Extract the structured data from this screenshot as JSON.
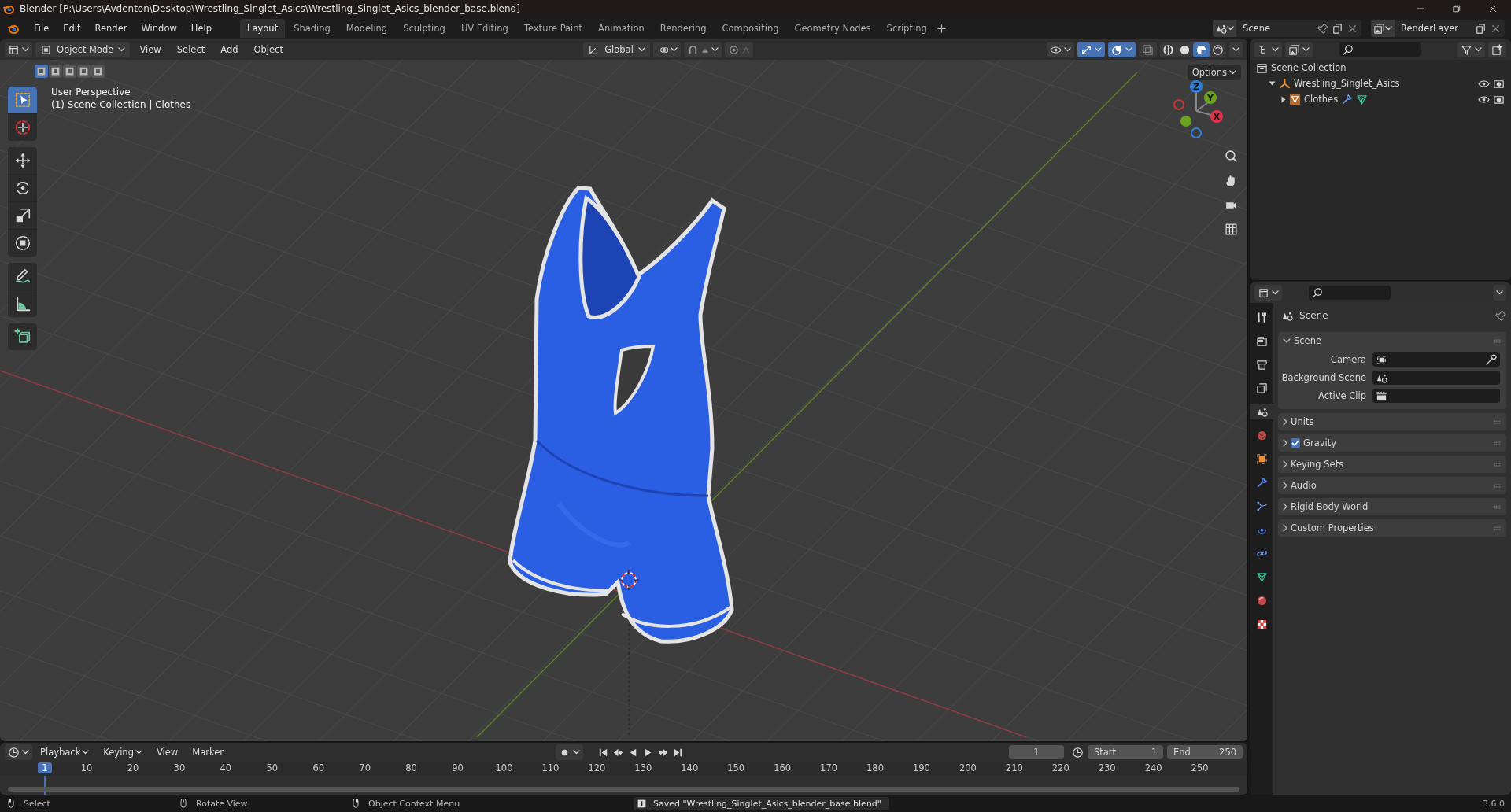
{
  "window": {
    "title": "Blender [P:\\Users\\Avdenton\\Desktop\\Wrestling_Singlet_Asics\\Wrestling_Singlet_Asics_blender_base.blend]"
  },
  "menu": [
    "File",
    "Edit",
    "Render",
    "Window",
    "Help"
  ],
  "workspaces": [
    {
      "label": "Layout",
      "selected": true
    },
    {
      "label": "Shading",
      "selected": false
    },
    {
      "label": "Modeling",
      "selected": false
    },
    {
      "label": "Sculpting",
      "selected": false
    },
    {
      "label": "UV Editing",
      "selected": false
    },
    {
      "label": "Texture Paint",
      "selected": false
    },
    {
      "label": "Animation",
      "selected": false
    },
    {
      "label": "Rendering",
      "selected": false
    },
    {
      "label": "Compositing",
      "selected": false
    },
    {
      "label": "Geometry Nodes",
      "selected": false
    },
    {
      "label": "Scripting",
      "selected": false
    }
  ],
  "scene": {
    "value": "Scene"
  },
  "view_layer": {
    "value": "RenderLayer"
  },
  "viewport": {
    "mode": "Object Mode",
    "menus": [
      "View",
      "Select",
      "Add",
      "Object"
    ],
    "orientation": "Global",
    "options": "Options",
    "toggles": [
      {
        "kind": "visibility",
        "on": false
      },
      {
        "kind": "gizmo",
        "on": true
      },
      {
        "kind": "overlay",
        "on": true
      },
      {
        "kind": "xray",
        "on": false
      }
    ],
    "shading": [
      {
        "kind": "wireframe",
        "selected": false
      },
      {
        "kind": "solid",
        "selected": false
      },
      {
        "kind": "material",
        "selected": true
      },
      {
        "kind": "rendered",
        "selected": false
      }
    ],
    "select_modes": [
      {
        "selected": true
      },
      {
        "selected": false
      },
      {
        "selected": false
      },
      {
        "selected": false
      },
      {
        "selected": false
      }
    ],
    "info": [
      "User Perspective",
      "(1) Scene Collection | Clothes"
    ],
    "tool_groups": [
      [
        {
          "kind": "select",
          "selected": true
        },
        {
          "kind": "cursor",
          "selected": false
        }
      ],
      [
        {
          "kind": "move",
          "selected": false
        },
        {
          "kind": "rotate",
          "selected": false
        },
        {
          "kind": "scale",
          "selected": false
        },
        {
          "kind": "transform",
          "selected": false
        }
      ],
      [
        {
          "kind": "annotate",
          "selected": false
        },
        {
          "kind": "measure",
          "selected": false
        }
      ],
      [
        {
          "kind": "add_cube",
          "selected": false
        }
      ]
    ],
    "axes": [
      {
        "label": "Z",
        "color": "#2e80d9"
      },
      {
        "label": "Y",
        "color": "#6ba31f"
      },
      {
        "label": "X",
        "color": "#e0334c"
      }
    ]
  },
  "outliner": {
    "tree": [
      {
        "label": "Scene Collection",
        "kind": "collection",
        "children": [
          {
            "label": "Wrestling_Singlet_Asics",
            "kind": "empty",
            "expanded": true,
            "children": [
              {
                "label": "Clothes",
                "kind": "mesh",
                "expanded": false
              }
            ]
          }
        ]
      }
    ]
  },
  "properties": {
    "tabs": [
      {
        "kind": "tool",
        "selected": false
      },
      {
        "kind": "render",
        "selected": false
      },
      {
        "kind": "output",
        "selected": false
      },
      {
        "kind": "view_layer",
        "selected": false
      },
      {
        "kind": "scene",
        "selected": true
      },
      {
        "kind": "world",
        "selected": false
      },
      {
        "kind": "object",
        "selected": false
      },
      {
        "kind": "modifiers",
        "selected": false
      },
      {
        "kind": "particles",
        "selected": false
      },
      {
        "kind": "physics",
        "selected": false
      },
      {
        "kind": "constraints",
        "selected": false
      },
      {
        "kind": "data",
        "selected": false
      },
      {
        "kind": "material",
        "selected": false
      },
      {
        "kind": "texture",
        "selected": false
      }
    ],
    "context": "Scene",
    "panels": [
      {
        "title": "Scene",
        "kind": "plain",
        "expanded": true,
        "fields": [
          {
            "label": "Camera",
            "kind": "object"
          },
          {
            "label": "Background Scene",
            "kind": "scene"
          },
          {
            "label": "Active Clip",
            "kind": "clip"
          }
        ]
      },
      {
        "title": "Units",
        "kind": "plain",
        "expanded": false
      },
      {
        "title": "Gravity",
        "kind": "checkbox",
        "checked": true,
        "expanded": false
      },
      {
        "title": "Keying Sets",
        "kind": "plain",
        "expanded": false
      },
      {
        "title": "Audio",
        "kind": "plain",
        "expanded": false
      },
      {
        "title": "Rigid Body World",
        "kind": "plain",
        "expanded": false
      },
      {
        "title": "Custom Properties",
        "kind": "plain",
        "expanded": false
      }
    ]
  },
  "timeline": {
    "menus": [
      "Playback",
      "Keying",
      "View",
      "Marker"
    ],
    "current_frame": "1",
    "start_label": "Start",
    "start": "1",
    "end_label": "End",
    "end": "250",
    "ruler": [
      {
        "label": "1",
        "selected": true
      },
      {
        "label": "10",
        "selected": false
      },
      {
        "label": "20",
        "selected": false
      },
      {
        "label": "30",
        "selected": false
      },
      {
        "label": "40",
        "selected": false
      },
      {
        "label": "50",
        "selected": false
      },
      {
        "label": "60",
        "selected": false
      },
      {
        "label": "70",
        "selected": false
      },
      {
        "label": "80",
        "selected": false
      },
      {
        "label": "90",
        "selected": false
      },
      {
        "label": "100",
        "selected": false
      },
      {
        "label": "110",
        "selected": false
      },
      {
        "label": "120",
        "selected": false
      },
      {
        "label": "130",
        "selected": false
      },
      {
        "label": "140",
        "selected": false
      },
      {
        "label": "150",
        "selected": false
      },
      {
        "label": "160",
        "selected": false
      },
      {
        "label": "170",
        "selected": false
      },
      {
        "label": "180",
        "selected": false
      },
      {
        "label": "190",
        "selected": false
      },
      {
        "label": "200",
        "selected": false
      },
      {
        "label": "210",
        "selected": false
      },
      {
        "label": "220",
        "selected": false
      },
      {
        "label": "230",
        "selected": false
      },
      {
        "label": "240",
        "selected": false
      },
      {
        "label": "250",
        "selected": false
      }
    ]
  },
  "status_bar": {
    "hints": [
      {
        "label": "Select",
        "kind": "left"
      },
      {
        "label": "Rotate View",
        "kind": "middle"
      },
      {
        "label": "Object Context Menu",
        "kind": "right"
      }
    ],
    "message": "Saved \"Wrestling_Singlet_Asics_blender_base.blend\"",
    "version": "3.6.0"
  }
}
